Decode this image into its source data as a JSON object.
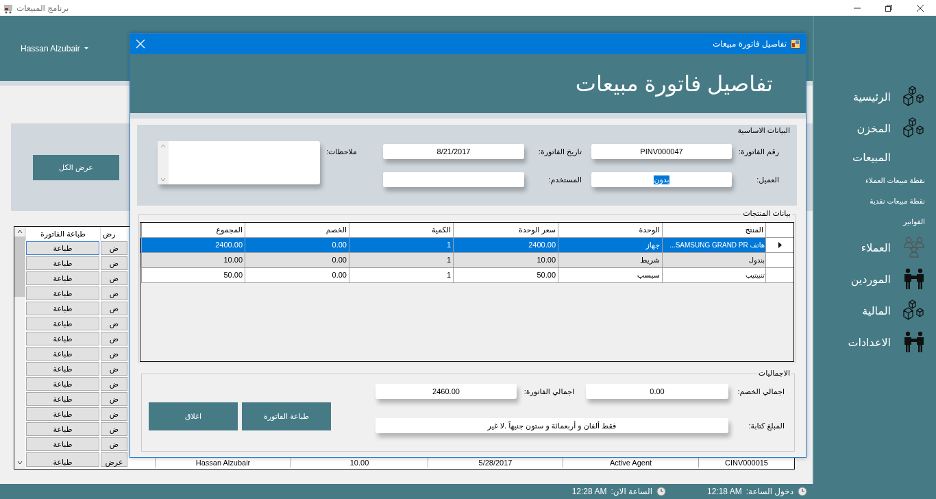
{
  "window": {
    "title": "برنامج المبيعات"
  },
  "user_menu": {
    "label": "Hassan Alzubair"
  },
  "show_all_button": "عرض الكل",
  "invoices_grid": {
    "columns": [
      "رض",
      "طباعة الفاتورة"
    ],
    "rows": [
      {
        "selected": true,
        "cells": [
          "ض",
          "طباعة"
        ]
      },
      {
        "selected": false,
        "cells": [
          "ض",
          "طباعة"
        ]
      },
      {
        "selected": false,
        "cells": [
          "ض",
          "طباعة"
        ]
      },
      {
        "selected": false,
        "cells": [
          "ض",
          "طباعة"
        ]
      },
      {
        "selected": false,
        "cells": [
          "ض",
          "طباعة"
        ]
      },
      {
        "selected": false,
        "cells": [
          "ض",
          "طباعة"
        ]
      },
      {
        "selected": false,
        "cells": [
          "ض",
          "طباعة"
        ]
      },
      {
        "selected": false,
        "cells": [
          "ض",
          "طباعة"
        ]
      },
      {
        "selected": false,
        "cells": [
          "ض",
          "طباعة"
        ]
      },
      {
        "selected": false,
        "cells": [
          "ض",
          "طباعة"
        ]
      },
      {
        "selected": false,
        "cells": [
          "ض",
          "طباعة"
        ]
      },
      {
        "selected": false,
        "cells": [
          "ض",
          "طباعة"
        ]
      },
      {
        "selected": false,
        "cells": [
          "ض",
          "طباعة"
        ]
      },
      {
        "selected": false,
        "cells": [
          "ض",
          "طباعة"
        ]
      },
      {
        "selected": false,
        "cells": [
          "CINV000015",
          "Active Agent",
          "5/28/2017",
          "10.00",
          "Hassan Alzubair",
          "عرض",
          "طباعة"
        ]
      }
    ]
  },
  "sidebar": {
    "items": [
      {
        "label": "الرئيسية"
      },
      {
        "label": "المخزن"
      },
      {
        "label": "المبيعات",
        "children": [
          {
            "label": "نقطة مبيعات العملاء"
          },
          {
            "label": "نقطة مبيعات نقدية"
          },
          {
            "label": "الفواتير"
          }
        ]
      },
      {
        "label": "العملاء"
      },
      {
        "label": "الموردين"
      },
      {
        "label": "المالية"
      },
      {
        "label": "الاعدادات"
      }
    ]
  },
  "dialog": {
    "title": "تفاصيل فاتورة مبيعات",
    "heading": "تفاصيل فاتورة مبيعات",
    "basic_info": {
      "title": "البيانات الاساسية",
      "invoice_number": {
        "label": "رقم الفاتورة:",
        "value": "PINV000047"
      },
      "invoice_date": {
        "label": "تاريخ الفاتورة:",
        "value": "8/21/2017"
      },
      "notes": {
        "label": "ملاحظات:"
      },
      "customer": {
        "label": "العميل:",
        "value": "بدون",
        "highlighted": true
      },
      "user": {
        "label": "المستخدم:"
      }
    },
    "products": {
      "title": "بيانات المنتجات",
      "columns": [
        "المنتج",
        "الوحدة",
        "سعر الوحدة",
        "الكمية",
        "الخصم",
        "المجموع"
      ],
      "rows": [
        {
          "selected": true,
          "cells": [
            "هاتف SAMSUNG GRAND PR...",
            "جهاز",
            "2400.00",
            "1",
            "0.00",
            "2400.00"
          ]
        },
        {
          "selected": false,
          "cells": [
            "بندول",
            "شريط",
            "10.00",
            "1",
            "0.00",
            "10.00"
          ]
        },
        {
          "selected": false,
          "cells": [
            "تنبيتيب",
            "سبسب",
            "50.00",
            "1",
            "0.00",
            "50.00"
          ]
        }
      ]
    },
    "totals": {
      "title": "الاجماليات",
      "total_discount": {
        "label": "اجمالي الخصم:",
        "value": "0.00"
      },
      "invoice_total": {
        "label": "اجمالي الفاتورة:",
        "value": "2460.00"
      },
      "amount_in_words": {
        "label": "المبلغ كتابة:",
        "value": "فقط ألفان و أربعمائة و ستون جنيهاً .لا غير"
      }
    },
    "buttons": [
      "طباعة الفاتورة",
      "اغلاق"
    ]
  },
  "status_bar": {
    "login_label": "دخول الساعة:",
    "login_time": "12:18 AM",
    "now_label": "الساعة الان:",
    "now_time": "12:28 AM"
  }
}
